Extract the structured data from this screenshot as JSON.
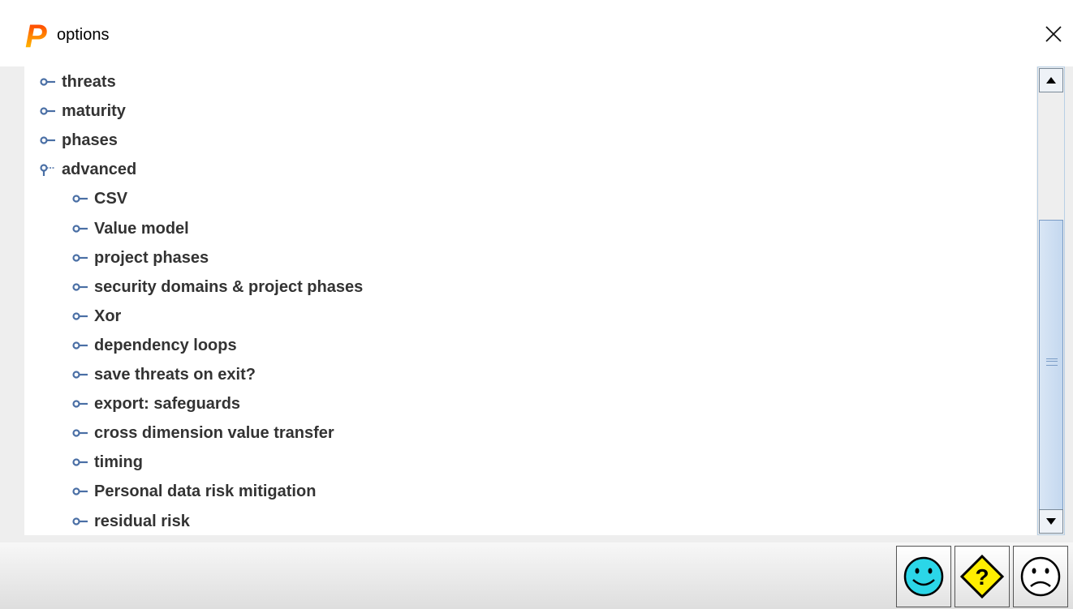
{
  "window": {
    "title": "options",
    "logo_letter": "P",
    "close_icon": "close-icon"
  },
  "tree": {
    "top_level": [
      {
        "label": "threats",
        "expanded": false
      },
      {
        "label": "maturity",
        "expanded": false
      },
      {
        "label": "phases",
        "expanded": false
      },
      {
        "label": "advanced",
        "expanded": true
      }
    ],
    "advanced_children": [
      {
        "label": "CSV"
      },
      {
        "label": "Value model"
      },
      {
        "label": "project phases"
      },
      {
        "label": "security domains & project phases"
      },
      {
        "label": "Xor"
      },
      {
        "label": "dependency loops"
      },
      {
        "label": "save threats on exit?"
      },
      {
        "label": "export: safeguards"
      },
      {
        "label": "cross dimension value transfer"
      },
      {
        "label": "timing"
      },
      {
        "label": "Personal data risk mitigation"
      },
      {
        "label": "residual risk"
      }
    ]
  },
  "scrollbar": {
    "up_icon": "arrow-up-icon",
    "down_icon": "arrow-down-icon",
    "thumb_position_fraction": 0.35,
    "thumb_size_fraction": 0.7
  },
  "actions": [
    {
      "name": "ok",
      "icon": "happy-face-icon",
      "color": "#2bd6e8"
    },
    {
      "name": "help",
      "icon": "help-diamond-icon",
      "color": "#ffee00"
    },
    {
      "name": "cancel",
      "icon": "sad-face-icon",
      "color": "#ffffff"
    }
  ],
  "colors": {
    "node_icon": "#4a6fa5",
    "text": "#333333",
    "logo_top": "#ff3b00",
    "logo_bottom": "#ffcc00"
  }
}
